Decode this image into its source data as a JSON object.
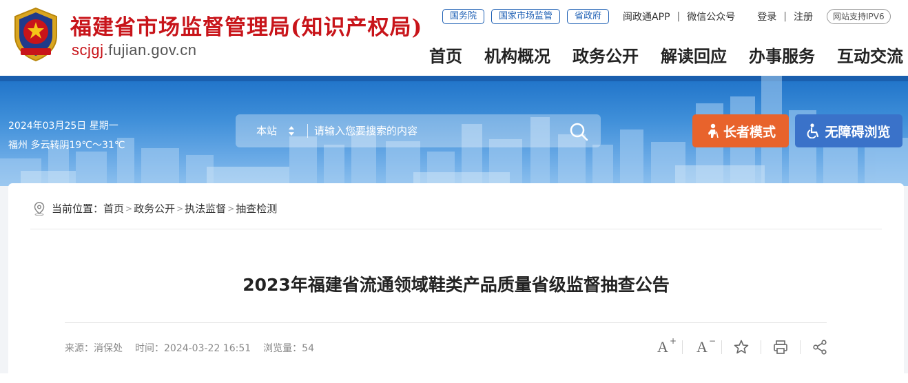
{
  "header": {
    "site_title": "福建省市场监督管理局(知识产权局)",
    "domain_highlight": "scjgj",
    "domain_rest": ".fujian.gov.cn",
    "top_links": [
      "国务院",
      "国家市场监管",
      "省政府"
    ],
    "app_link": "闽政通APP",
    "wechat_link": "微信公众号",
    "login": "登录",
    "register": "注册",
    "ipv6": "网站支持IPV6",
    "main_nav": [
      "首页",
      "机构概况",
      "政务公开",
      "解读回应",
      "办事服务",
      "互动交流"
    ]
  },
  "banner": {
    "date": "2024年03月25日 星期一",
    "weather": "福州 多云转阴19℃～31℃",
    "search_scope": "本站",
    "search_placeholder": "请输入您要搜索的内容",
    "elder_mode": "长者模式",
    "accessibility": "无障碍浏览"
  },
  "breadcrumb": {
    "prefix": "当前位置：",
    "items": [
      "首页",
      "政务公开",
      "执法监督",
      "抽查检测"
    ]
  },
  "article": {
    "title": "2023年福建省流通领域鞋类产品质量省级监督抽查公告",
    "source": "来源：消保处",
    "time": "时间：2024-03-22 16:51",
    "views": "浏览量：54"
  },
  "colors": {
    "brand_red": "#c8141a",
    "brand_blue": "#1d5fb4",
    "elder_orange": "#e8632c",
    "access_blue": "#3a72c9"
  }
}
